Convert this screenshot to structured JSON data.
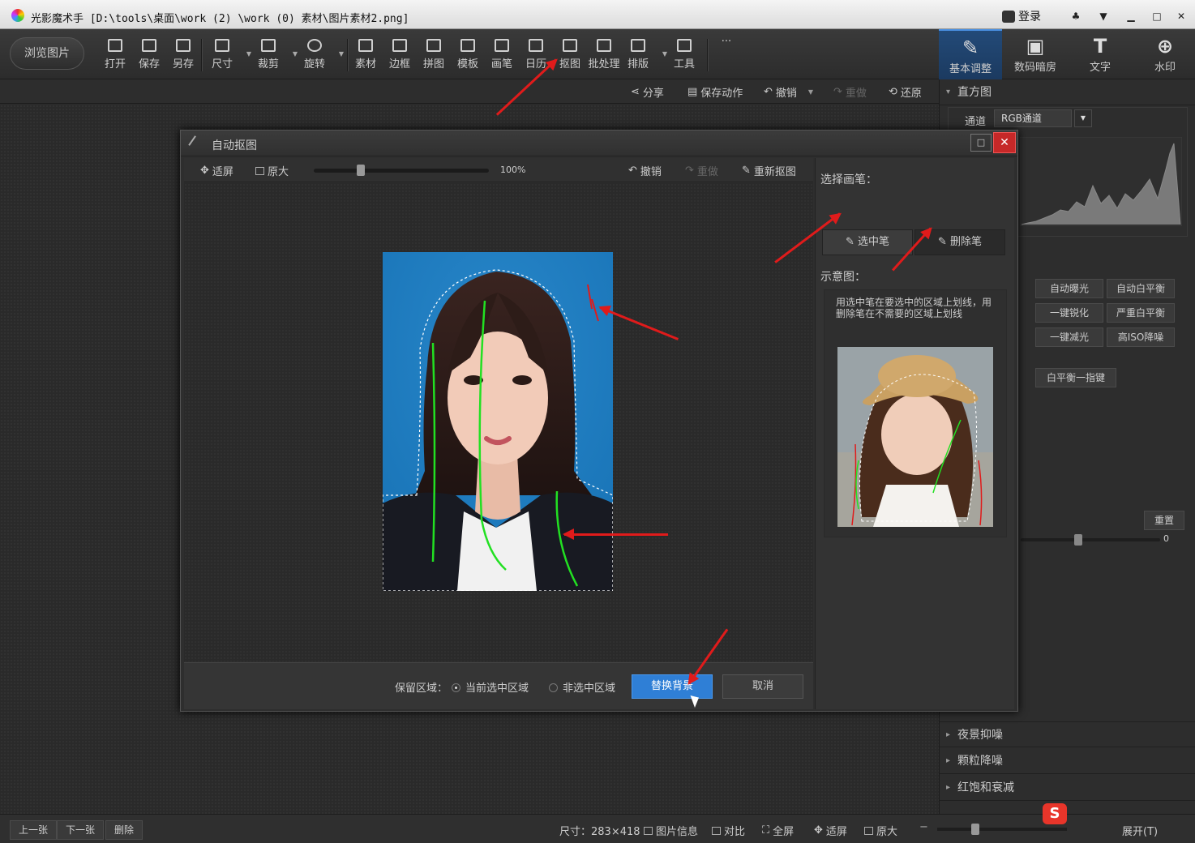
{
  "app": {
    "title": "光影魔术手  [D:\\tools\\桌面\\work (2) \\work (0) 素材\\图片素材2.png]",
    "login": "登录"
  },
  "toolbar": {
    "browse": "浏览图片",
    "tools": [
      "打开",
      "保存",
      "另存",
      "尺寸",
      "裁剪",
      "旋转",
      "素材",
      "边框",
      "拼图",
      "模板",
      "画笔",
      "日历",
      "抠图",
      "批处理",
      "排版",
      "工具"
    ],
    "more": "···",
    "right_tabs": [
      "基本调整",
      "数码暗房",
      "文字",
      "水印"
    ]
  },
  "actions": {
    "share": "分享",
    "save_action": "保存动作",
    "undo": "撤销",
    "redo": "重做",
    "restore": "还原"
  },
  "dialog": {
    "title": "自动抠图",
    "fit": "适屏",
    "original": "原大",
    "zoom": "100%",
    "zoom_fraction": 0.27,
    "undo": "撤销",
    "redo": "重做",
    "recut": "重新抠图",
    "choose_brush": "选择画笔：",
    "select_brush": "选中笔",
    "delete_brush": "删除笔",
    "diagram_label": "示意图：",
    "hint": "用选中笔在要选中的区域上划线，用删除笔在不需要的区域上划线",
    "keep_label": "保留区域：",
    "keep_current": "当前选中区域",
    "keep_other": "非选中区域",
    "replace_bg": "替换背景",
    "cancel": "取消"
  },
  "right_panel": {
    "histogram": "直方图",
    "channel_label": "通道",
    "channel_value": "RGB通道",
    "buttons": [
      "自动曝光",
      "自动白平衡",
      "一键锐化",
      "严重白平衡",
      "一键减光",
      "高ISO降噪"
    ],
    "wb_button": "白平衡一指键",
    "reset": "重置",
    "slider_value": "0",
    "sections": [
      "夜景抑噪",
      "颗粒降噪",
      "红饱和衰减"
    ]
  },
  "bottom": {
    "prev": "上一张",
    "next": "下一张",
    "delete": "删除",
    "size": "尺寸：283×418",
    "info": "图片信息",
    "compare": "对比",
    "fullscreen": "全屏",
    "fit": "适屏",
    "original": "原大",
    "expand": "展开(T)"
  },
  "colors": {
    "accent": "#4a90e2",
    "photo_bg": "#1d7dc2",
    "stroke_green": "#22e022",
    "stroke_red": "#e01b1b",
    "close_red": "#c62828"
  }
}
